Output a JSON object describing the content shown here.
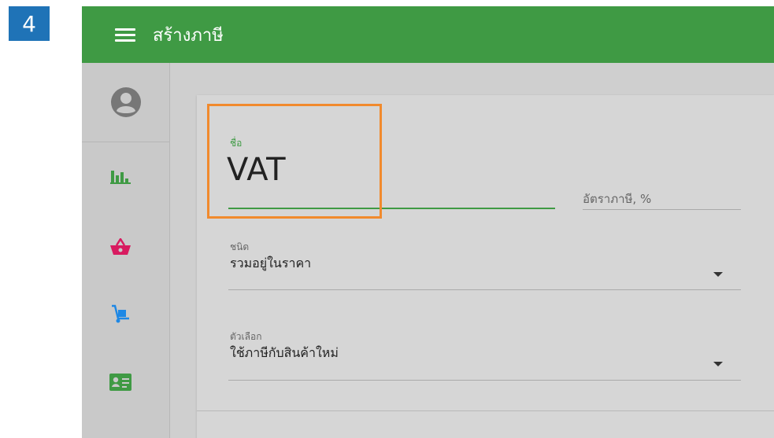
{
  "step": {
    "number": "4"
  },
  "appbar": {
    "title": "สร้างภาษี",
    "menu_icon": "hamburger-menu-icon",
    "color": "#3f9a44"
  },
  "sidebar": {
    "items": [
      {
        "name": "profile",
        "icon": "account-circle-icon",
        "color": "#777777"
      },
      {
        "name": "reports",
        "icon": "bar-chart-icon",
        "color": "#3f9a44"
      },
      {
        "name": "sales",
        "icon": "shopping-basket-icon",
        "color": "#d81b60"
      },
      {
        "name": "purchases",
        "icon": "hand-truck-icon",
        "color": "#1e88e5"
      },
      {
        "name": "contacts",
        "icon": "contact-card-icon",
        "color": "#3f9a44"
      }
    ]
  },
  "form": {
    "name": {
      "label": "ชื่อ",
      "value": "VAT"
    },
    "rate": {
      "placeholder": "อัตราภาษี, %"
    },
    "type": {
      "label": "ชนิด",
      "value": "รวมอยู่ในราคา"
    },
    "option": {
      "label": "ตัวเลือก",
      "value": "ใช้ภาษีกับสินค้าใหม่"
    }
  },
  "highlight_color": "#f18a2d"
}
